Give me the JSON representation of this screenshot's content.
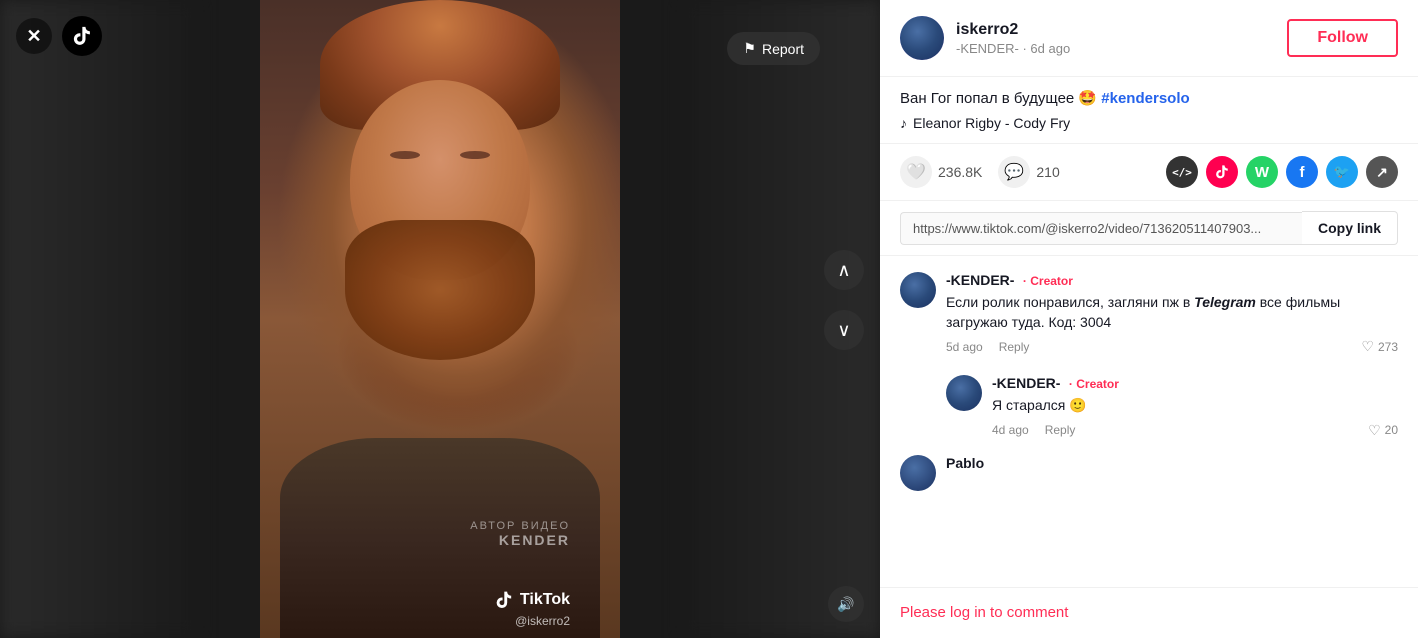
{
  "video": {
    "author_overlay": "АВТОР ВИДЕО\nKENDER",
    "watermark": "TikTok",
    "watermark_user": "@iskerro2",
    "report_label": "Report",
    "volume_icon": "🔊"
  },
  "post": {
    "username": "iskerro2",
    "handle": "-KENDER-",
    "time_ago": "6d ago",
    "caption": "Ван Гог попал в будущее 🤩 #kendersolo",
    "caption_text": "Ван Гог попал в будущее 🤩 ",
    "hashtag": "#kendersolo",
    "music_note": "♪",
    "music": "Eleanor Rigby - Cody Fry",
    "follow_label": "Follow",
    "likes_count": "236.8K",
    "comments_count": "210",
    "copy_link_url": "https://www.tiktok.com/@iskerro2/video/713620511407903...",
    "copy_link_label": "Copy link"
  },
  "comments": [
    {
      "id": 1,
      "username": "-KENDER-",
      "creator_badge": "· Creator",
      "text": "Если ролик понравился, загляни пж в ",
      "text_italic": "Telegram",
      "text_after": " все\nфильмы загружаю туда. Код: 3004",
      "time": "5d ago",
      "reply_label": "Reply",
      "likes": "273",
      "replies": [
        {
          "id": 11,
          "username": "-KENDER-",
          "creator_badge": "· Creator",
          "text": "Я старался 🙂",
          "time": "4d ago",
          "reply_label": "Reply",
          "likes": "20"
        }
      ]
    },
    {
      "id": 2,
      "username": "Pablo",
      "creator_badge": "",
      "text": "",
      "time": "",
      "likes": ""
    }
  ],
  "login_bar": {
    "text": "Please log in to comment"
  },
  "share": {
    "embed_icon": "</>",
    "tiktok_icon": "▶",
    "whatsapp_icon": "W",
    "facebook_icon": "f",
    "twitter_icon": "t",
    "more_icon": "↗"
  }
}
